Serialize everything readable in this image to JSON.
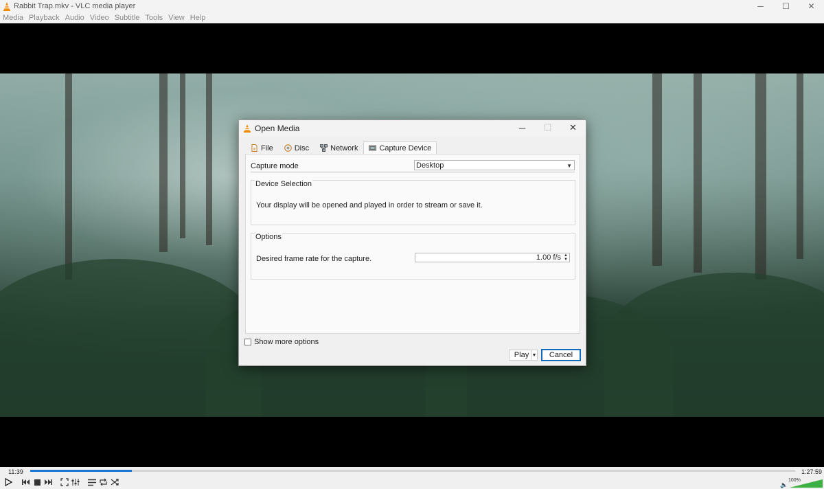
{
  "window": {
    "title": "Rabbit Trap.mkv - VLC media player",
    "controls": {
      "minimize": "─",
      "maximize": "☐",
      "close": "✕"
    }
  },
  "menubar": {
    "items": [
      "Media",
      "Playback",
      "Audio",
      "Video",
      "Subtitle",
      "Tools",
      "View",
      "Help"
    ]
  },
  "dialog": {
    "title": "Open Media",
    "controls": {
      "minimize": "─",
      "maximize": "☐",
      "close": "✕"
    },
    "tabs": [
      {
        "label": "File",
        "icon": "file-icon"
      },
      {
        "label": "Disc",
        "icon": "disc-icon"
      },
      {
        "label": "Network",
        "icon": "network-icon"
      },
      {
        "label": "Capture Device",
        "icon": "capture-device-icon",
        "active": true
      }
    ],
    "capture_mode": {
      "label": "Capture mode",
      "value": "Desktop"
    },
    "device_selection": {
      "title": "Device Selection",
      "text": "Your display will be opened and played in order to stream or save it."
    },
    "options": {
      "title": "Options",
      "frame_rate_label": "Desired frame rate for the capture.",
      "frame_rate_value": "1.00 f/s"
    },
    "show_more_options": {
      "label": "Show more options",
      "checked": false
    },
    "buttons": {
      "play": "Play",
      "cancel": "Cancel"
    }
  },
  "player": {
    "elapsed": "11:39",
    "total": "1:27:59",
    "progress": 0.133,
    "volume": "100%",
    "volume_level": 1.0
  },
  "colors": {
    "accent": "#1976d2",
    "focus_border": "#0f6cbd",
    "volume_green": "#3cb043"
  }
}
